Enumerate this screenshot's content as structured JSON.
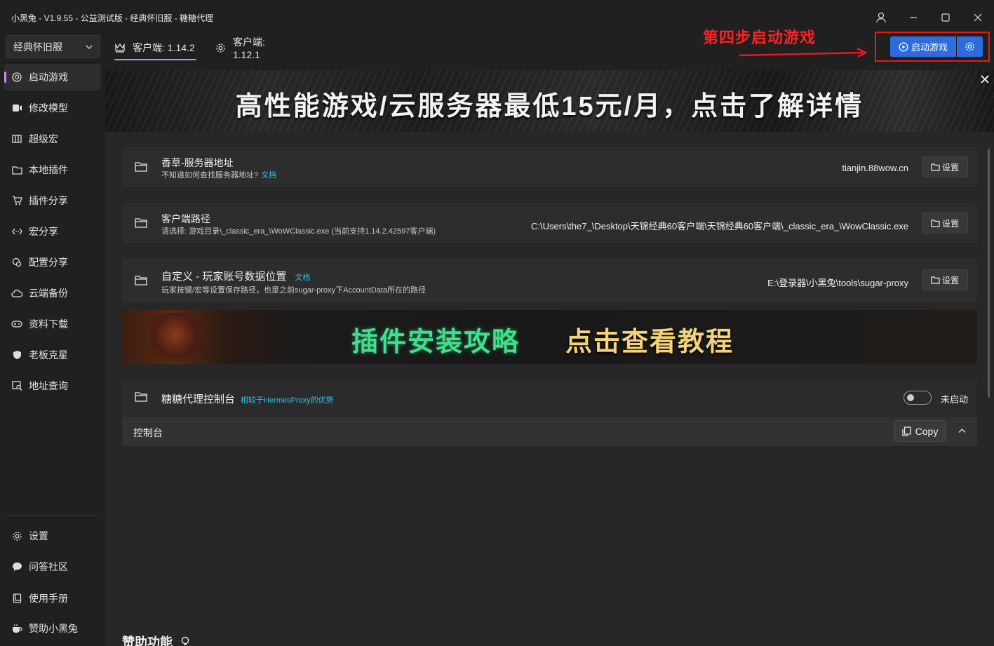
{
  "window": {
    "title": "小黑兔 - V1.9.55 - 公益测试版 - 经典怀旧服 - 糖糖代理"
  },
  "sidebar": {
    "game_select": "经典怀旧服",
    "items": [
      {
        "label": "启动游戏"
      },
      {
        "label": "修改模型"
      },
      {
        "label": "超级宏"
      },
      {
        "label": "本地插件"
      },
      {
        "label": "插件分享"
      },
      {
        "label": "宏分享"
      },
      {
        "label": "配置分享"
      },
      {
        "label": "云端备份"
      },
      {
        "label": "资料下载"
      },
      {
        "label": "老板克星"
      },
      {
        "label": "地址查询"
      }
    ],
    "bottom_items": [
      {
        "label": "设置"
      },
      {
        "label": "问答社区"
      },
      {
        "label": "使用手册"
      },
      {
        "label": "赞助小黑兔"
      }
    ]
  },
  "tabs": [
    {
      "label": "客户端: 1.14.2"
    },
    {
      "label": "客户端: 1.12.1"
    }
  ],
  "annotation": {
    "text": "第四步启动游戏"
  },
  "launch": {
    "label": "启动游戏"
  },
  "banner": {
    "text": "高性能游戏/云服务器最低15元/月，点击了解详情"
  },
  "cards": {
    "server": {
      "title": "香草-服务器地址",
      "subtitle": "不知道如何查找服务器地址?",
      "link": "文档",
      "value": "tianjin.88wow.cn",
      "button": "设置"
    },
    "client": {
      "title": "客户端路径",
      "subtitle": "请选择: 游戏目录\\_classic_era_\\WoWClassic.exe (当前支持1.14.2.42597客户端)",
      "value": "C:\\Users\\the7_\\Desktop\\天锦经典60客户端\\天锦经典60客户端\\_classic_era_\\WowClassic.exe",
      "button": "设置"
    },
    "account": {
      "title": "自定义 - 玩家账号数据位置",
      "link": "文档",
      "subtitle": "玩家按键/宏等设置保存路径，也是之前sugar-proxy下AccountData所在的路径",
      "value": "E:\\登录器\\小黑兔\\tools\\sugar-proxy",
      "button": "设置"
    }
  },
  "banner2": {
    "green": "插件安装攻略",
    "gold": "点击查看教程"
  },
  "proxy": {
    "title": "糖糖代理控制台",
    "link": "相较于HermesProxy的优势",
    "status": "未启动",
    "console_label": "控制台",
    "copy": "Copy"
  },
  "section": {
    "title": "赞助功能"
  },
  "colors": {
    "accent": "#c58af9",
    "launch_blue": "#2d6cdf",
    "annotation_red": "#e21b1b",
    "link": "#35c2e6"
  }
}
